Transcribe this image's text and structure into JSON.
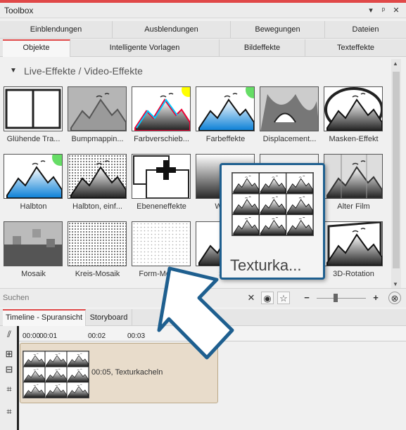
{
  "window": {
    "title": "Toolbox",
    "controls": [
      "▾",
      "ᵖ",
      "✕"
    ]
  },
  "tabs_row1": [
    "Einblendungen",
    "Ausblendungen",
    "Bewegungen",
    "Dateien"
  ],
  "tabs_row2": [
    "Objekte",
    "Intelligente Vorlagen",
    "Bildeffekte",
    "Texteffekte"
  ],
  "active_tab": "Objekte",
  "category": {
    "toggle": "▼",
    "title": "Live-Effekte / Video-Effekte"
  },
  "effects": [
    {
      "label": "Glühende Tra...",
      "icon": "split-frame-icon"
    },
    {
      "label": "Bumpmappin...",
      "icon": "emboss-icon"
    },
    {
      "label": "Farbverschieb...",
      "icon": "color-shift-icon"
    },
    {
      "label": "Farbeffekte",
      "icon": "color-effects-icon"
    },
    {
      "label": "Displacement...",
      "icon": "displacement-icon"
    },
    {
      "label": "Masken-Effekt",
      "icon": "mask-ellipse-icon"
    },
    {
      "label": "Halbton",
      "icon": "halftone-color-icon"
    },
    {
      "label": "Halbton, einf...",
      "icon": "halftone-gray-icon"
    },
    {
      "label": "Ebeneneffekte",
      "icon": "layer-plus-icon"
    },
    {
      "label": "Weich",
      "icon": "soften-icon"
    },
    {
      "label": "",
      "icon": "hidden-icon"
    },
    {
      "label": "Alter Film",
      "icon": "old-film-icon"
    },
    {
      "label": "Mosaik",
      "icon": "mosaic-icon"
    },
    {
      "label": "Kreis-Mosaik",
      "icon": "circle-mosaic-icon"
    },
    {
      "label": "Form-Mosaik",
      "icon": "shape-mosaic-icon"
    },
    {
      "label": "Sch",
      "icon": "shadow-icon"
    },
    {
      "label": "",
      "icon": "hidden-icon"
    },
    {
      "label": "3D-Rotation",
      "icon": "rotate-3d-icon"
    }
  ],
  "popup": {
    "label": "Texturka..."
  },
  "search": {
    "placeholder": "Suchen"
  },
  "bottom_tabs": [
    "Timeline - Spuransicht",
    "Storyboard"
  ],
  "ruler": {
    "marks": [
      "00:00",
      "00:01",
      "00:02",
      "00:03"
    ]
  },
  "clip": {
    "label": "00:05, Texturkacheln"
  },
  "colors": {
    "accent": "#e04848",
    "popup_border": "#1e5f8f",
    "clip_bg": "#e8dccb"
  }
}
